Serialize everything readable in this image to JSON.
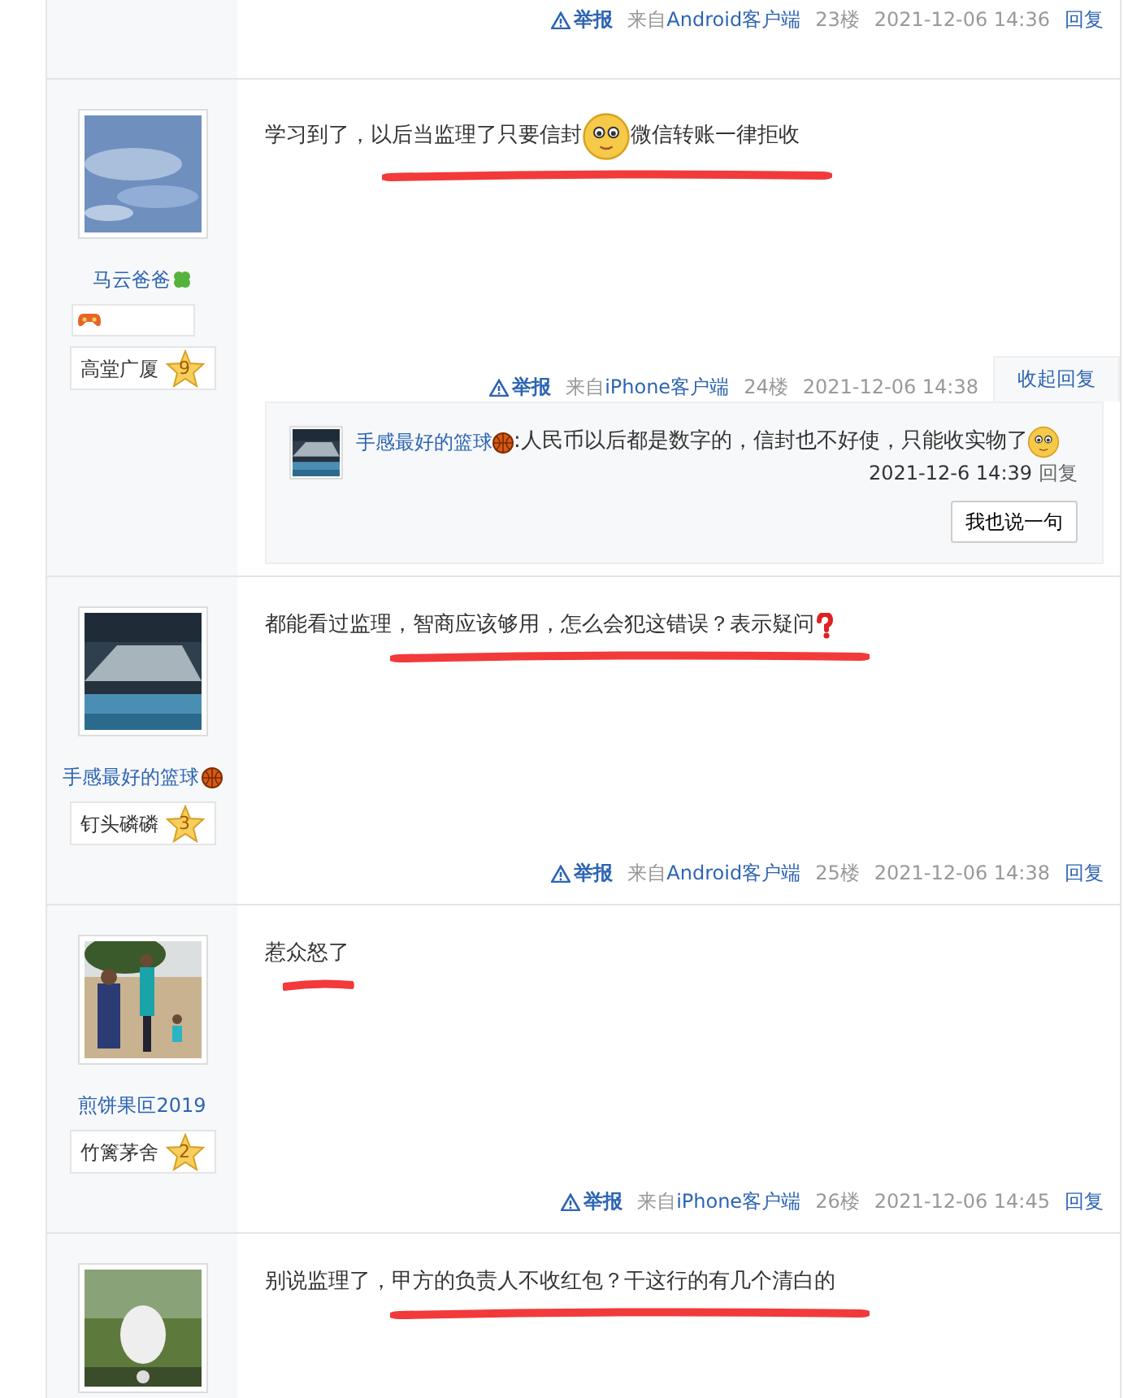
{
  "posts": [
    {
      "footer": {
        "report": "举报",
        "from_label": "来自",
        "client": "Android客户端",
        "floor": "23楼",
        "date": "2021-12-06 14:36",
        "reply": "回复"
      }
    },
    {
      "author": "马云爸爸",
      "name_icon": {
        "kind": "clover"
      },
      "game_badge": true,
      "level_title": "高堂广厦",
      "level": "9",
      "underlined": true,
      "content": [
        {
          "kind": "text",
          "text": "学习到了，以后当监理了只要信封"
        },
        {
          "kind": "emoji"
        },
        {
          "kind": "text",
          "text": "微信转账一律拒收"
        }
      ],
      "footer": {
        "report": "举报",
        "from_label": "来自",
        "client": "iPhone客户端",
        "floor": "24楼",
        "date": "2021-12-06 14:38",
        "reply": "收起回复"
      },
      "replies_expanded": true,
      "replies": [
        {
          "author": "手感最好的篮球",
          "name_icon": {
            "kind": "basketball"
          },
          "sep": ":",
          "content": [
            {
              "kind": "text",
              "text": "人民币以后都是数字的，信封也不好使，只能收实物了"
            },
            {
              "kind": "emoji"
            }
          ],
          "date": "2021-12-6 14:39",
          "reply": "回复"
        }
      ],
      "reply_button": "我也说一句"
    },
    {
      "author": "手感最好的篮球",
      "name_icon": {
        "kind": "basketball"
      },
      "level_title": "钉头磷磷",
      "level": "3",
      "underlined": true,
      "content": [
        {
          "kind": "text",
          "text": "都能看过监理，智商应该够用，怎么会犯这错误？表示疑问"
        },
        {
          "kind": "question"
        }
      ],
      "footer": {
        "report": "举报",
        "from_label": "来自",
        "client": "Android客户端",
        "floor": "25楼",
        "date": "2021-12-06 14:38",
        "reply": "回复"
      }
    },
    {
      "author": "煎饼果叵2019",
      "level_title": "竹篱茅舍",
      "level": "2",
      "underlined": true,
      "content": [
        {
          "kind": "text",
          "text": "惹众怒了"
        }
      ],
      "footer": {
        "report": "举报",
        "from_label": "来自",
        "client": "iPhone客户端",
        "floor": "26楼",
        "date": "2021-12-06 14:45",
        "reply": "回复"
      }
    },
    {
      "underlined": true,
      "content": [
        {
          "kind": "text",
          "text": "别说监理了，甲方的负责人不收红包？干这行的有几个清白的"
        }
      ]
    }
  ]
}
